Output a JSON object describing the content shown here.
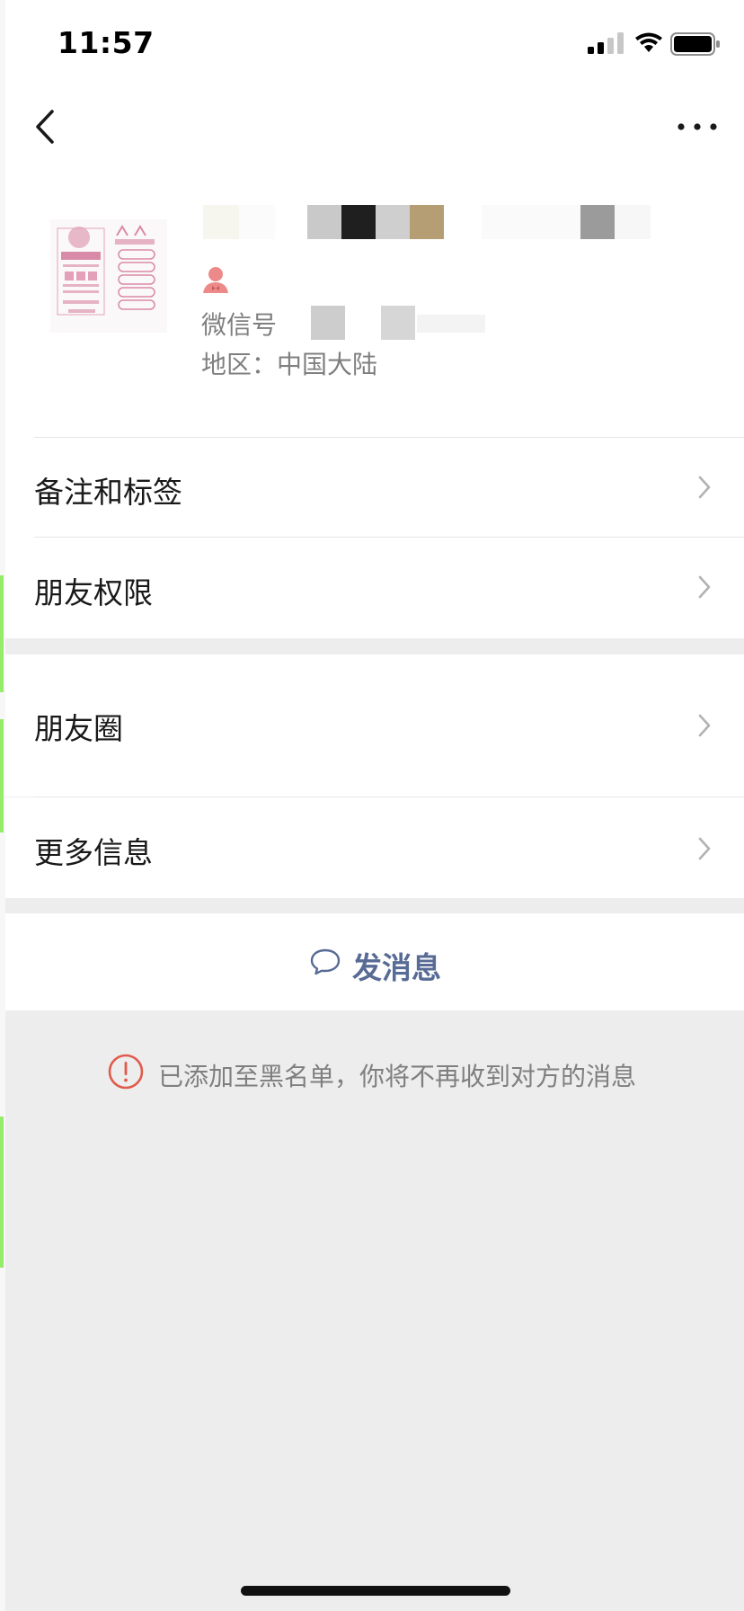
{
  "status_bar": {
    "time": "11:57"
  },
  "profile": {
    "wechat_id_label": "微信号",
    "region_label": "地区：中国大陆"
  },
  "menu_group_1": [
    {
      "label": "备注和标签"
    },
    {
      "label": "朋友权限"
    }
  ],
  "menu_group_2": [
    {
      "label": "朋友圈"
    },
    {
      "label": "更多信息"
    }
  ],
  "send_message": {
    "label": "发消息",
    "color": "#576b95"
  },
  "blacklist_notice": {
    "text": "已添加至黑名单，你将不再收到对方的消息",
    "icon_color": "#e15a4c"
  },
  "icons": {
    "back": "chevron-left-icon",
    "more": "ellipsis-icon",
    "gender": "person-icon",
    "chevron": "chevron-right-icon",
    "message": "chat-bubble-icon",
    "warning": "exclamation-circle-icon"
  }
}
